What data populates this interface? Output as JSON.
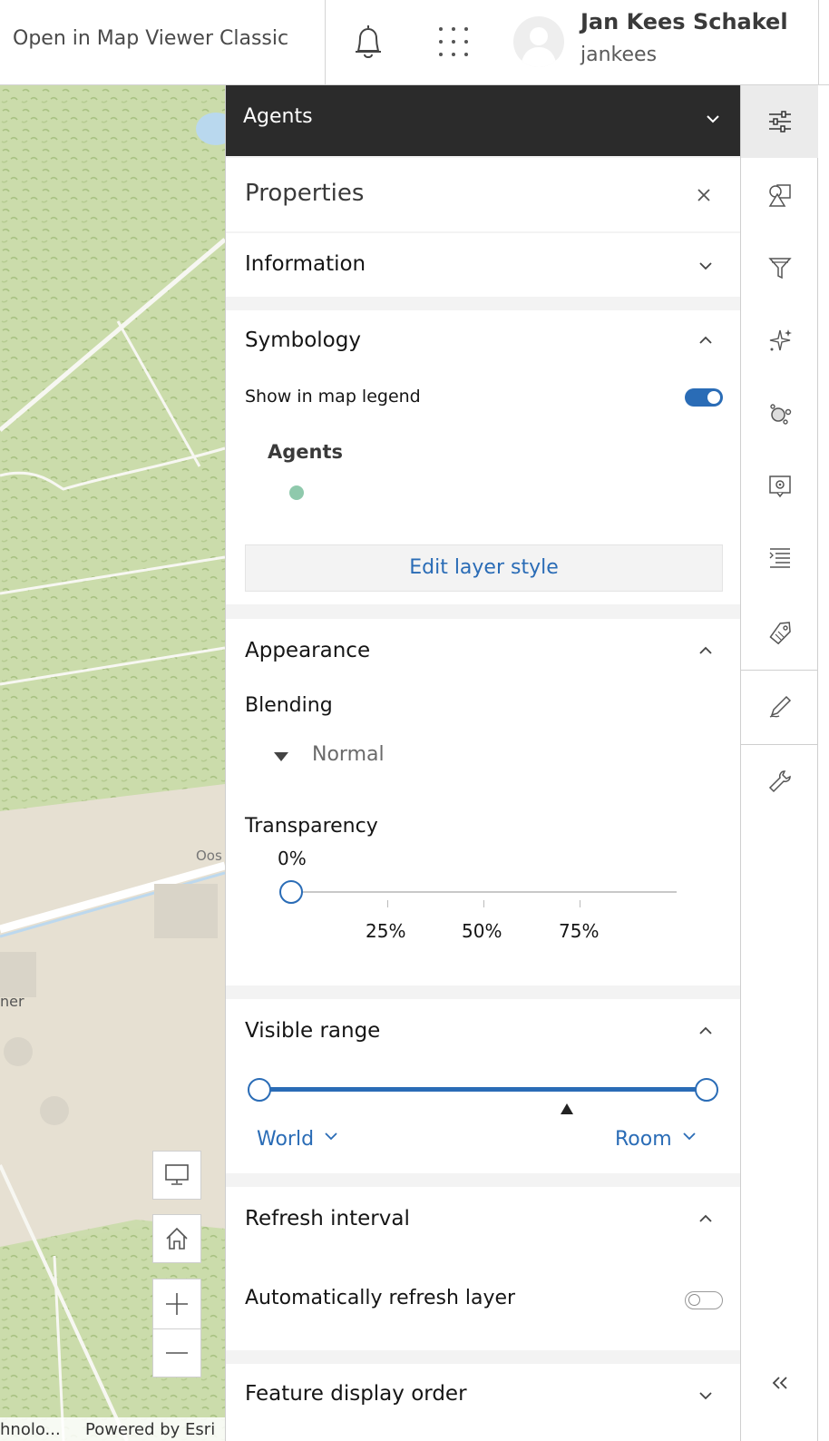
{
  "header": {
    "open_classic": "Open in Map Viewer Classic",
    "user_name": "Jan Kees Schakel",
    "user_id": "jankees"
  },
  "map": {
    "road_label": "Oos",
    "place_label": "ner",
    "attribution_left": "hnolo...",
    "attribution_right": "Powered by Esri"
  },
  "panel": {
    "layer_title": "Agents",
    "properties_title": "Properties",
    "information": "Information",
    "symbology": {
      "title": "Symbology",
      "show_legend": "Show in map legend",
      "show_legend_on": true,
      "legend_layer": "Agents",
      "symbol_color": "#8fc9ac",
      "edit_style": "Edit layer style"
    },
    "appearance": {
      "title": "Appearance",
      "blending_label": "Blending",
      "blending_value": "Normal",
      "transparency_label": "Transparency",
      "transparency_value": "0%",
      "transparency_percent": 0,
      "ticks": [
        "25%",
        "50%",
        "75%"
      ]
    },
    "visible_range": {
      "title": "Visible range",
      "min_label": "World",
      "max_label": "Room"
    },
    "refresh": {
      "title": "Refresh interval",
      "auto_label": "Automatically refresh layer",
      "auto_on": false
    },
    "feature_order": "Feature display order"
  },
  "colors": {
    "accent": "#2a6cb6",
    "dark_bar": "#2b2b2b",
    "map_green": "#c9d9a8",
    "map_tan": "#e8e1d3"
  }
}
